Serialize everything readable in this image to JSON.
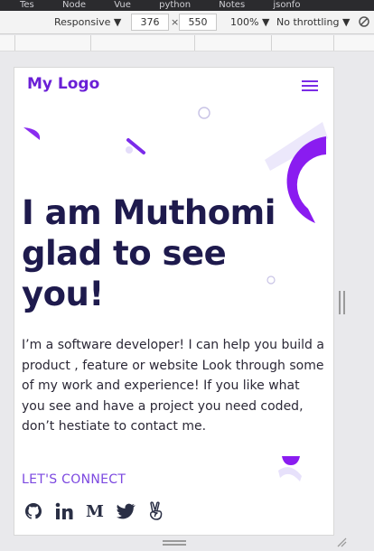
{
  "browser": {
    "tabs_strip": [
      "Tes",
      "Node",
      "Vue",
      "python",
      "Notes",
      "jsonfo"
    ]
  },
  "device_toolbar": {
    "mode": "Responsive ▼",
    "width": "376",
    "separator": "×",
    "height": "550",
    "zoom": "100% ▼",
    "throttle": "No throttling ▼"
  },
  "site": {
    "logo": "My Logo",
    "hero_title_lines": [
      "I am Muthomi",
      "glad to see",
      "you!"
    ],
    "hero_title": "I am Muthomi glad to see you!",
    "description": "I’m a software developer! I can help you build a product , feature or website Look through some of my work and experience! If you like what you see and have a project you need coded, don’t hestiate to contact me.",
    "connect_label": "LET'S CONNECT",
    "socials": [
      {
        "name": "github",
        "icon": "github-icon"
      },
      {
        "name": "linkedin",
        "icon": "linkedin-icon"
      },
      {
        "name": "medium",
        "icon": "medium-icon"
      },
      {
        "name": "twitter",
        "icon": "twitter-icon"
      },
      {
        "name": "angellist",
        "icon": "angellist-icon"
      }
    ]
  },
  "colors": {
    "brand": "#6a1fd6",
    "accent": "#7c48e0",
    "title": "#1e1a4d",
    "shape_purple": "#8a2bf0",
    "shape_lavender": "#ebe6fb"
  }
}
